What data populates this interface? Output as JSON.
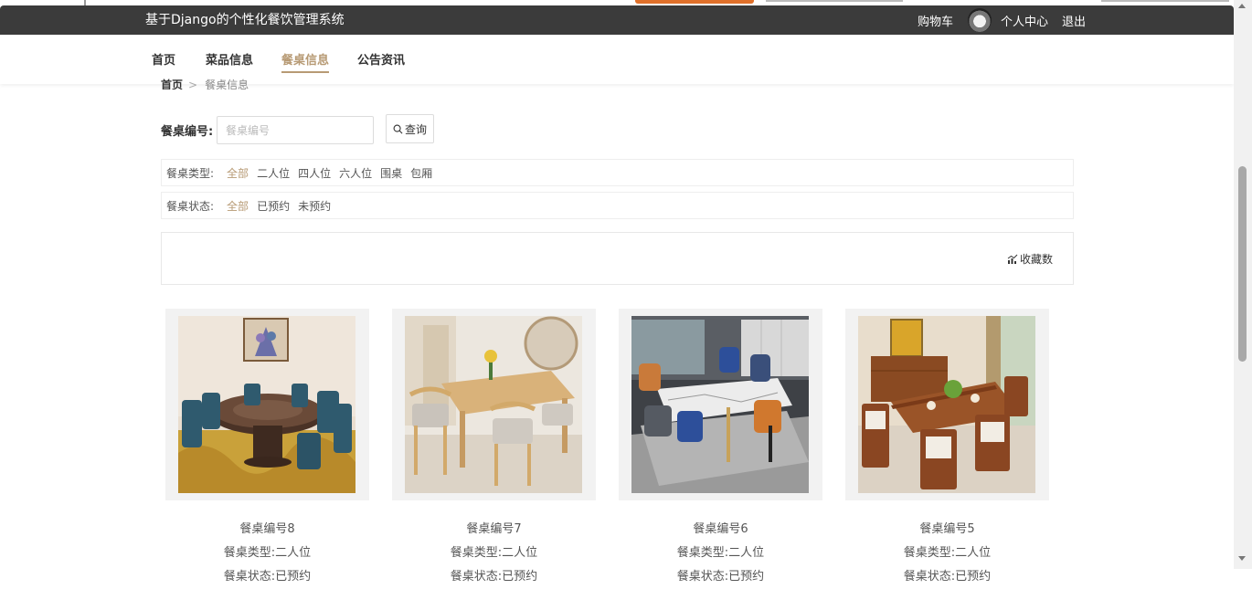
{
  "header": {
    "brand": "基于Django的个性化餐饮管理系统",
    "cart": "购物车",
    "user_center": "个人中心",
    "logout": "退出"
  },
  "nav": {
    "items": [
      {
        "label": "首页"
      },
      {
        "label": "菜品信息"
      },
      {
        "label": "餐桌信息",
        "active": true
      },
      {
        "label": "公告资讯"
      }
    ]
  },
  "breadcrumb": {
    "home": "首页",
    "sep": ">",
    "current": "餐桌信息"
  },
  "search": {
    "label": "餐桌编号:",
    "placeholder": "餐桌编号",
    "value": "",
    "button": "查询"
  },
  "filters": {
    "type": {
      "label": "餐桌类型:",
      "options": [
        "全部",
        "二人位",
        "四人位",
        "六人位",
        "围桌",
        "包厢"
      ],
      "selected": "全部"
    },
    "status": {
      "label": "餐桌状态:",
      "options": [
        "全部",
        "已预约",
        "未预约"
      ],
      "selected": "全部"
    }
  },
  "sort": {
    "button": "收藏数"
  },
  "cards": [
    {
      "number": "餐桌编号8",
      "type": "餐桌类型:二人位",
      "status": "餐桌状态:已预约"
    },
    {
      "number": "餐桌编号7",
      "type": "餐桌类型:二人位",
      "status": "餐桌状态:已预约"
    },
    {
      "number": "餐桌编号6",
      "type": "餐桌类型:二人位",
      "status": "餐桌状态:已预约"
    },
    {
      "number": "餐桌编号5",
      "type": "餐桌类型:二人位",
      "status": "餐桌状态:已预约"
    }
  ],
  "colors": {
    "accent": "#b79a74",
    "topbar": "#3b3b3b"
  }
}
